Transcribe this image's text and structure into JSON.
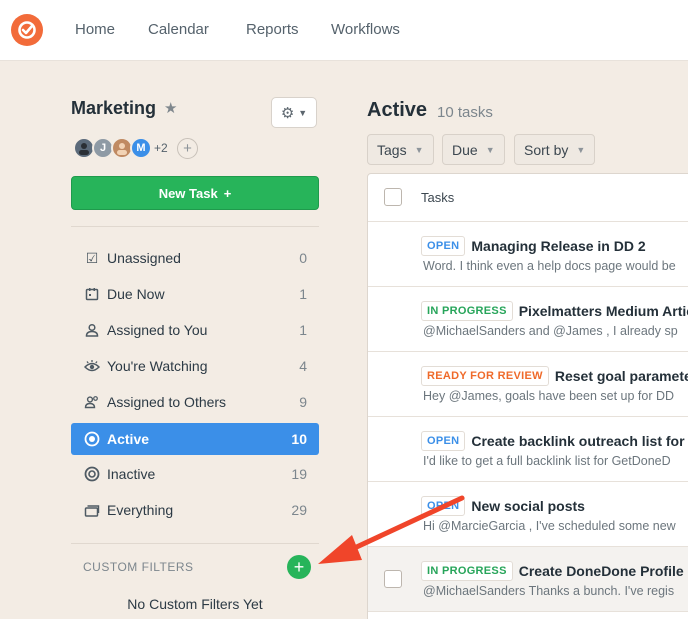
{
  "nav": {
    "items": [
      "Home",
      "Calendar",
      "Reports",
      "Workflows"
    ]
  },
  "sidebar": {
    "project_title": "Marketing",
    "members_more": "+2",
    "avatars": [
      {
        "initial": "",
        "color": "#5b6a7a"
      },
      {
        "initial": "J",
        "color": "#8e9aa5"
      },
      {
        "initial": "",
        "color": "#c08a62"
      },
      {
        "initial": "M",
        "color": "#3b8fe8"
      }
    ],
    "new_task_label": "New Task",
    "items": [
      {
        "label": "Unassigned",
        "count": "0",
        "icon": "checkbox-icon"
      },
      {
        "label": "Due Now",
        "count": "1",
        "icon": "calendar-icon"
      },
      {
        "label": "Assigned to You",
        "count": "1",
        "icon": "user-icon"
      },
      {
        "label": "You're Watching",
        "count": "4",
        "icon": "eye-icon"
      },
      {
        "label": "Assigned to Others",
        "count": "9",
        "icon": "users-icon"
      },
      {
        "label": "Active",
        "count": "10",
        "icon": "target-icon"
      },
      {
        "label": "Inactive",
        "count": "19",
        "icon": "circle-icon"
      },
      {
        "label": "Everything",
        "count": "29",
        "icon": "stack-icon"
      }
    ],
    "custom_filters_label": "CUSTOM FILTERS",
    "no_custom_filters": "No Custom Filters Yet"
  },
  "main": {
    "title": "Active",
    "count_label": "10 tasks",
    "filters": [
      "Tags",
      "Due",
      "Sort by"
    ],
    "list_header": "Tasks",
    "tasks": [
      {
        "status": "OPEN",
        "status_class": "b-open",
        "title": "Managing Release in DD 2",
        "snippet": "Word. I think even a help docs page would be"
      },
      {
        "status": "IN PROGRESS",
        "status_class": "b-prog",
        "title": "Pixelmatters Medium Artic",
        "snippet": "@MichaelSanders and @James , I already sp"
      },
      {
        "status": "READY FOR REVIEW",
        "status_class": "b-rev",
        "title": "Reset goal parameter",
        "snippet": "Hey @James, goals have been set up for DD"
      },
      {
        "status": "OPEN",
        "status_class": "b-open",
        "title": "Create backlink outreach list for",
        "snippet": "I'd like to get a full backlink list for GetDoneD"
      },
      {
        "status": "OPEN",
        "status_class": "b-open",
        "title": "New social posts",
        "snippet": "Hi @MarcieGarcia ,  I've scheduled some new"
      },
      {
        "status": "IN PROGRESS",
        "status_class": "b-prog",
        "title": "Create DoneDone Profile o",
        "snippet": "@MichaelSanders Thanks a bunch. I've regis"
      }
    ]
  },
  "colors": {
    "accent": "#3b8fe8",
    "success": "#27b45a",
    "brand": "#f26b3a",
    "annotation_arrow": "#f0452a"
  }
}
